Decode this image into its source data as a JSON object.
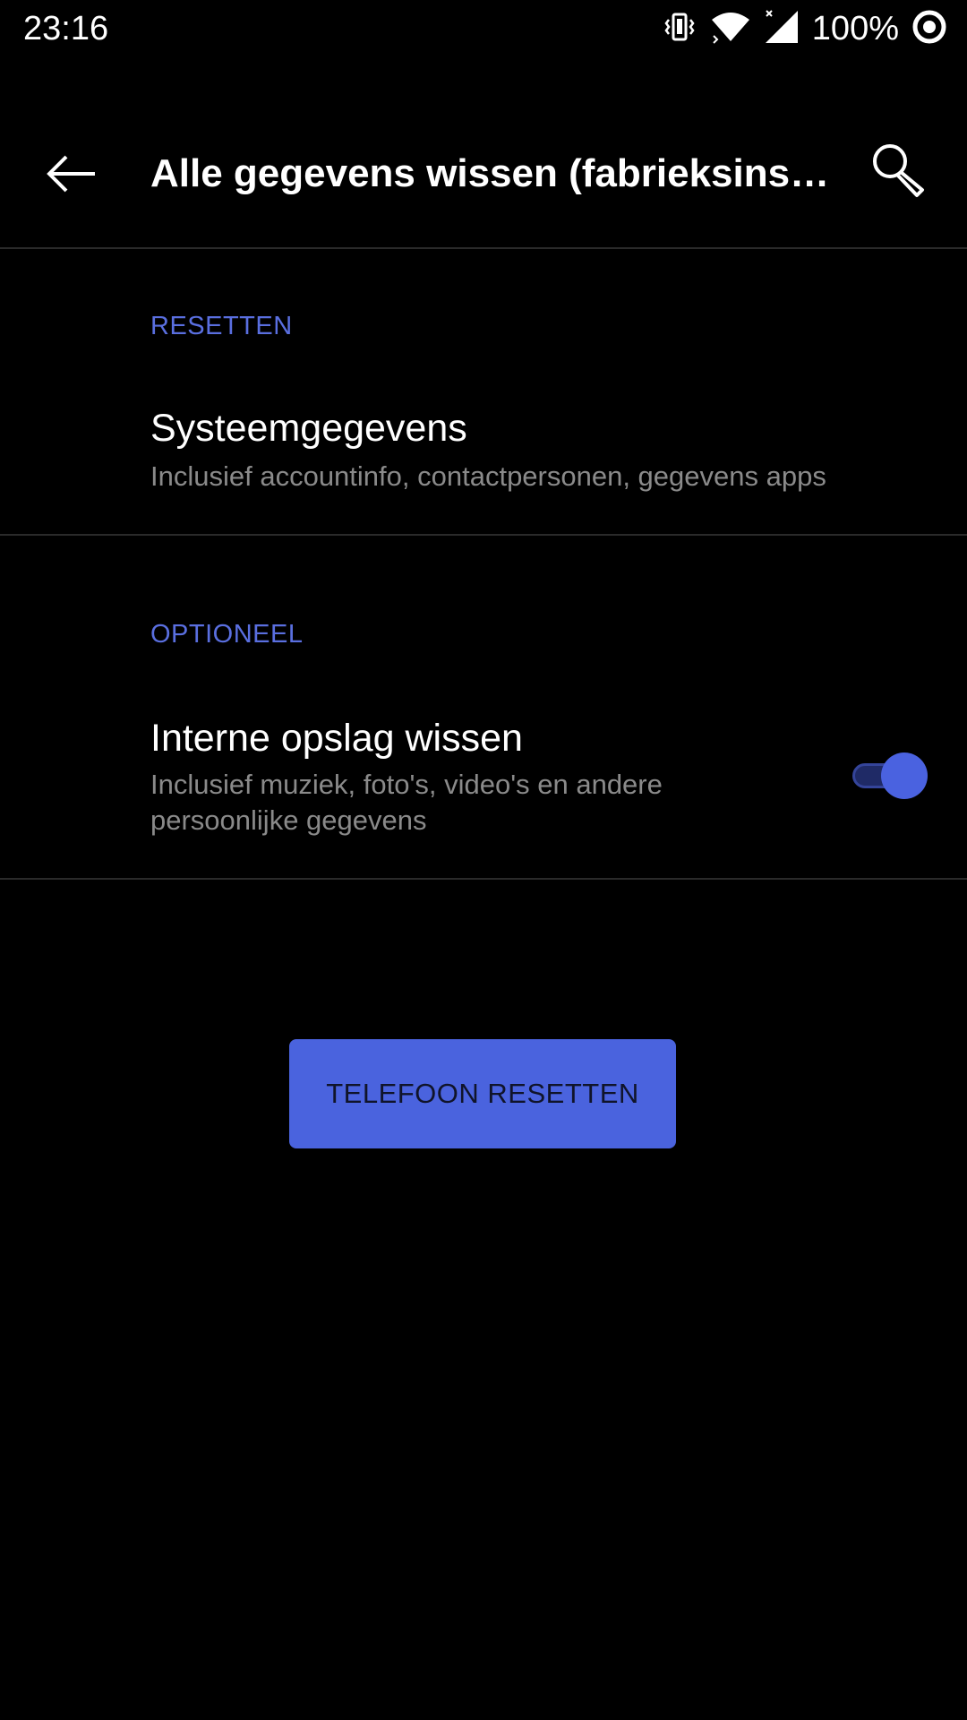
{
  "status_bar": {
    "time": "23:16",
    "battery_percent": "100%",
    "icons": [
      "vibrate-icon",
      "wifi-icon",
      "signal-icon",
      "battery-icon"
    ]
  },
  "app_bar": {
    "title": "Alle gegevens wissen (fabrieksins…",
    "back_icon": "arrow-back-icon",
    "search_icon": "search-icon"
  },
  "sections": {
    "reset": {
      "header": "RESETTEN",
      "item_title": "Systeemgegevens",
      "item_summary": "Inclusief accountinfo, contactpersonen, gegevens apps"
    },
    "optional": {
      "header": "OPTIONEEL",
      "item_title": "Interne opslag wissen",
      "item_summary_line1": "Inclusief muziek, foto's, video's en andere",
      "item_summary_line2": "persoonlijke gegevens",
      "toggle_on": true
    }
  },
  "reset_button": {
    "label": "TELEFOON RESETTEN"
  },
  "colors": {
    "background": "#000000",
    "accent": "#4a63de",
    "section_header": "#5a6fe0",
    "summary_text": "#8a8a8a"
  }
}
